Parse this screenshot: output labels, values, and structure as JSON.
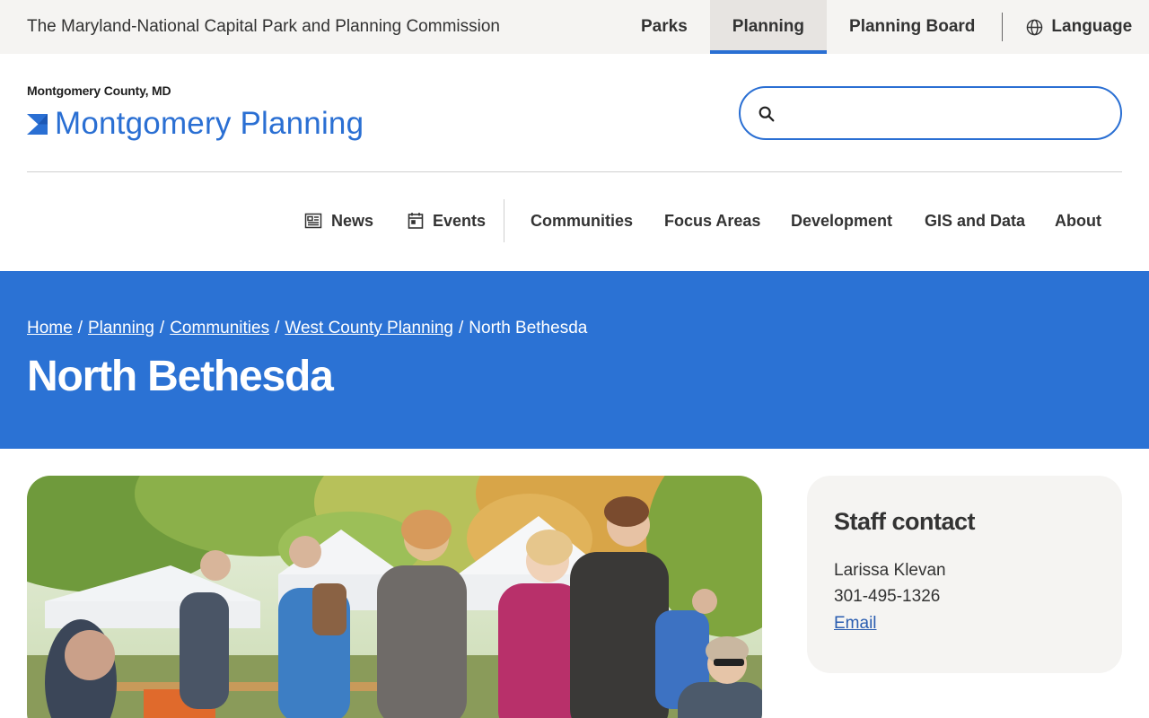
{
  "topbar": {
    "org_name": "The Maryland-National Capital Park and Planning Commission",
    "tabs": [
      {
        "label": "Parks",
        "active": false
      },
      {
        "label": "Planning",
        "active": true
      },
      {
        "label": "Planning Board",
        "active": false
      }
    ],
    "language_label": "Language"
  },
  "header": {
    "county": "Montgomery County, MD",
    "logo_text": "Montgomery Planning",
    "search_placeholder": ""
  },
  "mainnav": {
    "news": "News",
    "events": "Events",
    "communities": "Communities",
    "focus_areas": "Focus Areas",
    "development": "Development",
    "gis": "GIS and Data",
    "about": "About"
  },
  "breadcrumb": {
    "home": "Home",
    "planning": "Planning",
    "communities": "Communities",
    "west_county": "West County Planning",
    "current": "North Bethesda",
    "separator": "/"
  },
  "page_title": "North Bethesda",
  "staff_contact": {
    "heading": "Staff contact",
    "name": "Larissa Klevan",
    "phone": "301-495-1326",
    "email_label": "Email"
  },
  "colors": {
    "brand_blue": "#2a6fd3",
    "hero_blue": "#2b72d4",
    "topbar_bg": "#f5f4f2"
  }
}
